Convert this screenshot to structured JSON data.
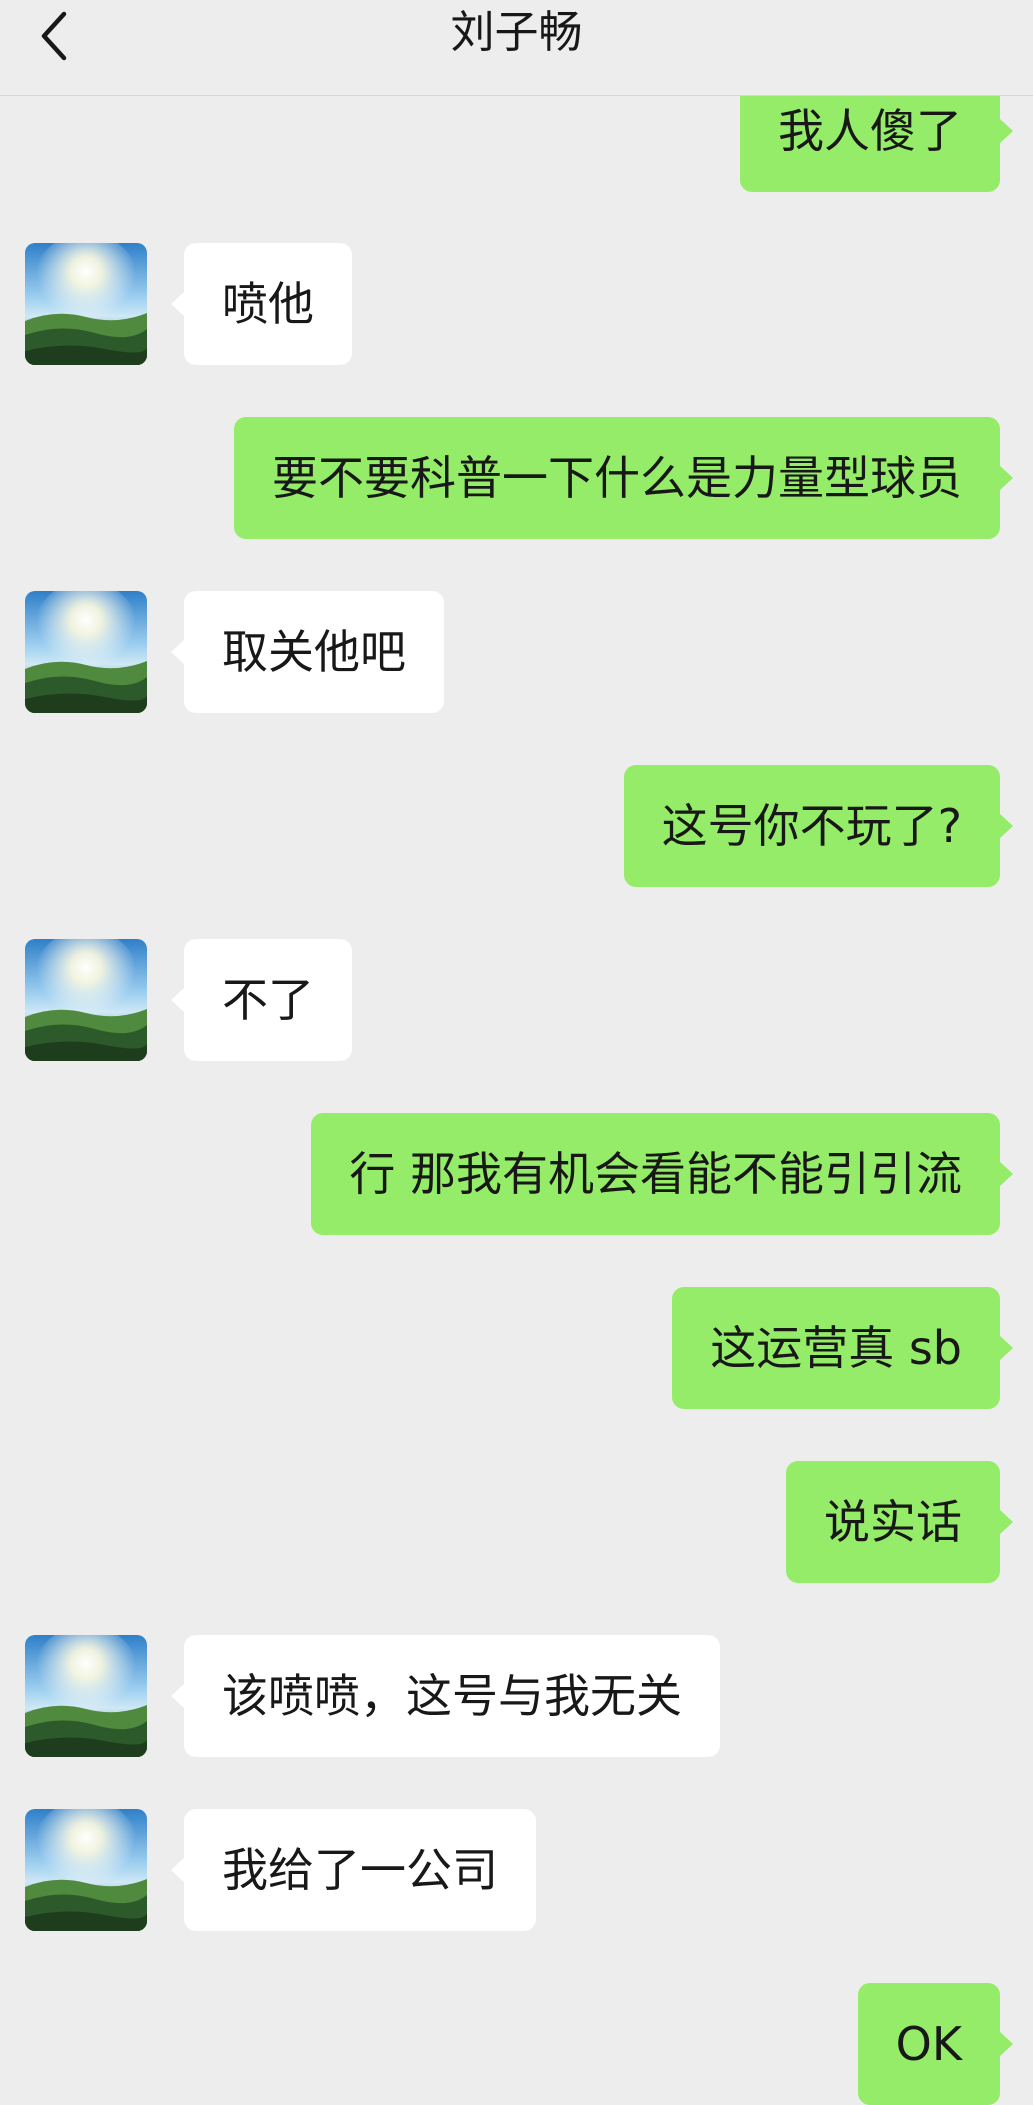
{
  "header": {
    "title": "刘子畅",
    "back_icon": "chevron-left-icon"
  },
  "contact": {
    "avatar_icon": "sunrise-landscape-avatar"
  },
  "colors": {
    "background": "#ededed",
    "outgoing_bubble": "#95ec69",
    "incoming_bubble": "#ffffff",
    "text": "#181818"
  },
  "messages": [
    {
      "side": "out",
      "text": "我人傻了"
    },
    {
      "side": "in",
      "text": "喷他"
    },
    {
      "side": "out",
      "text": "要不要科普一下什么是力量型球员"
    },
    {
      "side": "in",
      "text": "取关他吧"
    },
    {
      "side": "out",
      "text": "这号你不玩了?"
    },
    {
      "side": "in",
      "text": "不了"
    },
    {
      "side": "out",
      "text": "行 那我有机会看能不能引引流"
    },
    {
      "side": "out",
      "text": "这运营真 sb"
    },
    {
      "side": "out",
      "text": "说实话"
    },
    {
      "side": "in",
      "text": "该喷喷，这号与我无关"
    },
    {
      "side": "in",
      "text": "我给了一公司"
    },
    {
      "side": "out",
      "text": "OK"
    }
  ]
}
